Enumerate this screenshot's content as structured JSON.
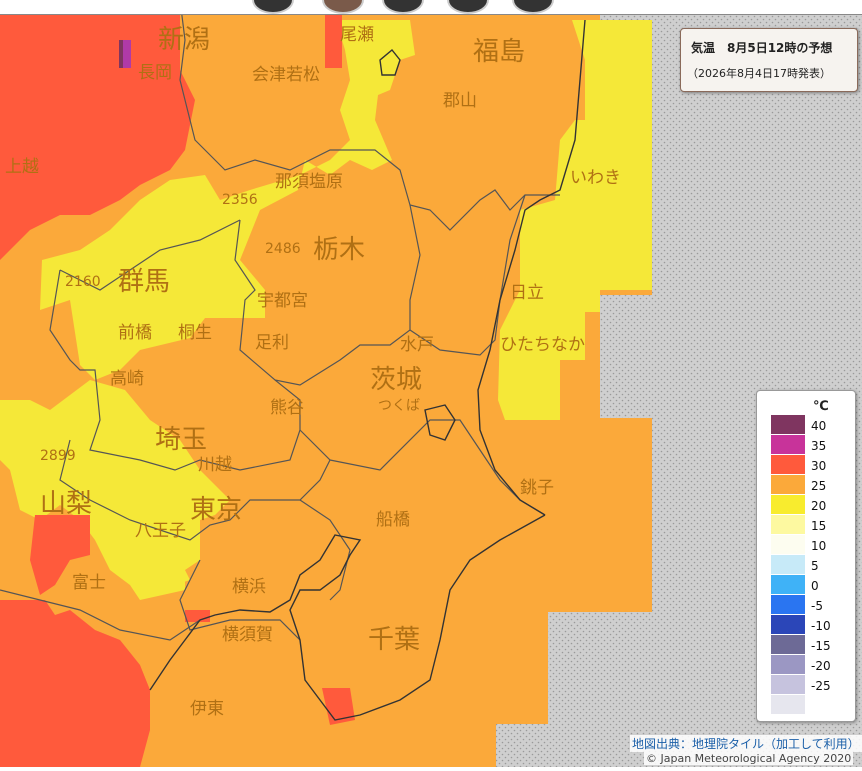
{
  "title": {
    "main": "気温　8月5日12時の予想",
    "sub": "（2026年8月4日17時発表）"
  },
  "legend": {
    "unit": "℃",
    "items": [
      {
        "label": "40",
        "color": "#7f3560"
      },
      {
        "label": "35",
        "color": "#c8339a"
      },
      {
        "label": "30",
        "color": "#ff5a3c"
      },
      {
        "label": "25",
        "color": "#fba93a"
      },
      {
        "label": "20",
        "color": "#f8ec2e"
      },
      {
        "label": "15",
        "color": "#fdf9a0"
      },
      {
        "label": "10",
        "color": "#fdfdf0"
      },
      {
        "label": "5",
        "color": "#c7eaf8"
      },
      {
        "label": "0",
        "color": "#3fb2f7"
      },
      {
        "label": "-5",
        "color": "#2a75f1"
      },
      {
        "label": "-10",
        "color": "#2b46b8"
      },
      {
        "label": "-15",
        "color": "#6d6a96"
      },
      {
        "label": "-20",
        "color": "#9b97c3"
      },
      {
        "label": "-25",
        "color": "#c6c3de"
      },
      {
        "label": "",
        "color": "#e6e6ee"
      }
    ]
  },
  "place_labels": {
    "niigata": "新潟",
    "nagaoka": "長岡",
    "joetsu": "上越",
    "fukushima": "福島",
    "koriyama": "郡山",
    "iwaki": "いわき",
    "aizu": "会津若松",
    "nasu": "那須塩原",
    "tochigi": "栃木",
    "utsunomiya": "宇都宮",
    "gunma": "群馬",
    "maebashi": "前橋",
    "kiryu": "桐生",
    "takasaki": "高崎",
    "ibaraki": "茨城",
    "mito": "水戸",
    "hitachi": "日立",
    "hitachinaka": "ひたちなか",
    "tsukuba": "つくば",
    "saitama": "埼玉",
    "kumagaya": "熊谷",
    "kawagoe": "川越",
    "tokyo": "東京",
    "hachioji": "八王子",
    "yamanashi": "山梨",
    "chiba": "千葉",
    "funabashi": "船橋",
    "choshi": "銚子",
    "yokohama": "横浜",
    "yokosuka": "横須賀",
    "ito": "伊東",
    "fuji": "富士",
    "ashikaga": "足利",
    "oze": "尾瀬",
    "elev1": "2160",
    "elev2": "2486",
    "elev3": "2356",
    "elev4": "2899"
  },
  "credits": {
    "tiles": "地図出典：地理院タイル（加工して利用）",
    "copyright": "© Japan Meteorological Agency 2020"
  }
}
